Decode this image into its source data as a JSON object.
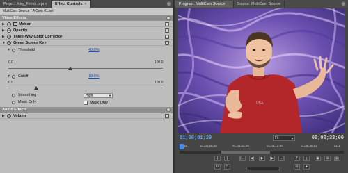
{
  "left_panel": {
    "tabs": [
      {
        "label": "Project: Key_Finish.prproj",
        "active": false
      },
      {
        "label": "Effect Controls",
        "active": true
      }
    ],
    "clip_name": "MultiCam Source * A Cam 01.avi",
    "video_effects": {
      "header": "Video Effects",
      "effects": [
        {
          "label": "Motion",
          "icon": "motion-icon"
        },
        {
          "label": "Opacity"
        },
        {
          "label": "Three-Way Color Corrector"
        },
        {
          "label": "Green Screen Key"
        }
      ],
      "threshold": {
        "label": "Threshold",
        "value": "40.0%",
        "min": "0.0",
        "max": "100.0",
        "level": 0.4
      },
      "cutoff": {
        "label": "Cutoff",
        "value": "18.0%",
        "min": "0.0",
        "max": "100.0",
        "level": 0.18
      },
      "smoothing": {
        "label": "Smoothing",
        "selected": "High"
      },
      "mask_only_left": "Mask Only",
      "mask_only_right": "Mask Only"
    },
    "audio_effects": {
      "header": "Audio Effects",
      "effects": [
        {
          "label": "Volume"
        }
      ]
    }
  },
  "right_panel": {
    "tabs": [
      {
        "label": "Program: MultiCam Source",
        "active": true
      },
      {
        "label": "Source: MultiCam Source",
        "active": false
      }
    ],
    "timecode_current": "01;00;01;29",
    "zoom": "Fit",
    "timecode_duration": "00;00;33;00",
    "ruler_labels": [
      "18",
      "01;01;55;20",
      "01;04;03;26",
      "01;06;12;00",
      "01;08;20;04",
      "01;1"
    ]
  },
  "colors": {
    "accent": "#3e8cff",
    "panel_bg": "#bdbdbd",
    "section_bg": "#8f8f8f",
    "link": "#1a4fbf"
  }
}
